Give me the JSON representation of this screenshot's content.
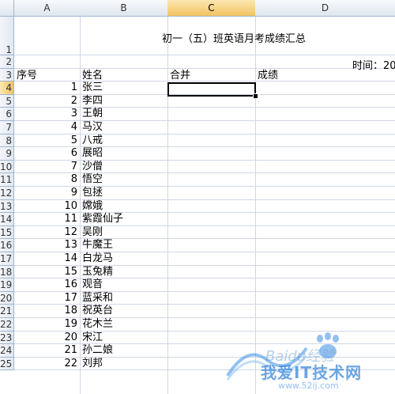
{
  "columns": [
    "A",
    "B",
    "C",
    "D"
  ],
  "row_numbers": [
    "1",
    "2",
    "3",
    "4",
    "5",
    "6",
    "7",
    "8",
    "9",
    "10",
    "11",
    "12",
    "13",
    "14",
    "15",
    "16",
    "17",
    "18",
    "19",
    "20",
    "21",
    "22",
    "23",
    "24",
    "25"
  ],
  "title": "初一（五）班英语月考成绩汇总",
  "time_label": "时间：20",
  "headers": {
    "seq": "序号",
    "name": "姓名",
    "merge": "合并",
    "score": "成绩"
  },
  "students": [
    {
      "seq": "1",
      "name": "张三"
    },
    {
      "seq": "2",
      "name": "李四"
    },
    {
      "seq": "3",
      "name": "王朝"
    },
    {
      "seq": "4",
      "name": "马汉"
    },
    {
      "seq": "5",
      "name": "八戒"
    },
    {
      "seq": "6",
      "name": "展昭"
    },
    {
      "seq": "7",
      "name": "沙僧"
    },
    {
      "seq": "8",
      "name": "悟空"
    },
    {
      "seq": "9",
      "name": "包拯"
    },
    {
      "seq": "10",
      "name": "嫦娥"
    },
    {
      "seq": "11",
      "name": "紫霞仙子"
    },
    {
      "seq": "12",
      "name": "吴刚"
    },
    {
      "seq": "13",
      "name": "牛魔王"
    },
    {
      "seq": "14",
      "name": "白龙马"
    },
    {
      "seq": "15",
      "name": "玉兔精"
    },
    {
      "seq": "16",
      "name": "观音"
    },
    {
      "seq": "17",
      "name": "蓝采和"
    },
    {
      "seq": "18",
      "name": "祝英台"
    },
    {
      "seq": "19",
      "name": "花木兰"
    },
    {
      "seq": "20",
      "name": "宋江"
    },
    {
      "seq": "21",
      "name": "孙二娘"
    },
    {
      "seq": "22",
      "name": "刘邦"
    }
  ],
  "selected": {
    "column": "C",
    "row": "4"
  },
  "watermark": {
    "brand": "Baidu经验",
    "text": "我爱IT技术网",
    "url": "www.52ij.com"
  },
  "colors": {
    "header_selected": "#f2c35f",
    "gridline": "#d0d7e5",
    "header_border": "#9eb6ce",
    "watermark_blue": "#3a8ee6"
  }
}
